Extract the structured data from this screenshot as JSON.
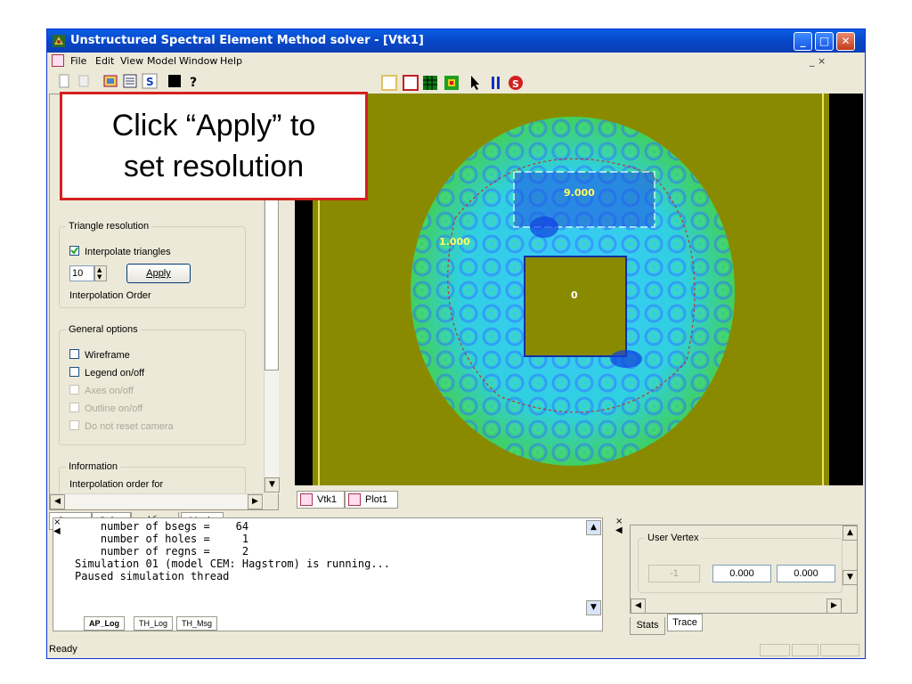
{
  "window": {
    "title": "Unstructured Spectral Element Method solver - [Vtk1]"
  },
  "menu": {
    "items": [
      "File",
      "Edit",
      "View",
      "Model",
      "Window",
      "Help"
    ],
    "mdi_controls": "_ ×"
  },
  "left_panel": {
    "triangle_group_label": "Triangle resolution",
    "interpolate_triangles_label": "Interpolate triangles",
    "interpolate_checked": true,
    "order_value": "10",
    "apply_label": "Apply",
    "interpolation_order_label": "Interpolation Order",
    "general_options_label": "General options",
    "wireframe_label": "Wireframe",
    "legend_label": "Legend on/off",
    "axes_label": "Axes on/off",
    "outline_label": "Outline on/off",
    "do_not_reset_label": "Do not reset camera",
    "information_label": "Information",
    "information_text": "Interpolation order for"
  },
  "left_tabs": [
    "Geom",
    "Solve",
    "Viz",
    "Movie"
  ],
  "viewer": {
    "labels": {
      "top": "9.000",
      "left": "1.000",
      "center": "0"
    }
  },
  "doc_tabs": [
    "Vtk1",
    "Plot1"
  ],
  "log": {
    "lines": [
      "    number of bsegs =    64",
      "    number of holes =     1",
      "    number of regns =     2",
      "",
      "",
      "Simulation 01 (model CEM: Hagstrom) is running...",
      "Paused simulation thread"
    ],
    "tabs": [
      "AP_Log",
      "TH_Log",
      "TH_Msg"
    ]
  },
  "right_panel": {
    "group_label": "User Vertex",
    "vertex_index": "-1",
    "x_value": "0.000",
    "y_value": "0.000",
    "tabs": [
      "Stats",
      "Trace"
    ]
  },
  "status": {
    "text": "Ready"
  },
  "callout": {
    "line1": "Click “Apply” to",
    "line2": "set resolution"
  },
  "colors": {
    "titlebar": "#0a4fd8",
    "callout_border": "#d62020",
    "viewer_bg": "#8a8a00",
    "field_bg": "#000000"
  }
}
